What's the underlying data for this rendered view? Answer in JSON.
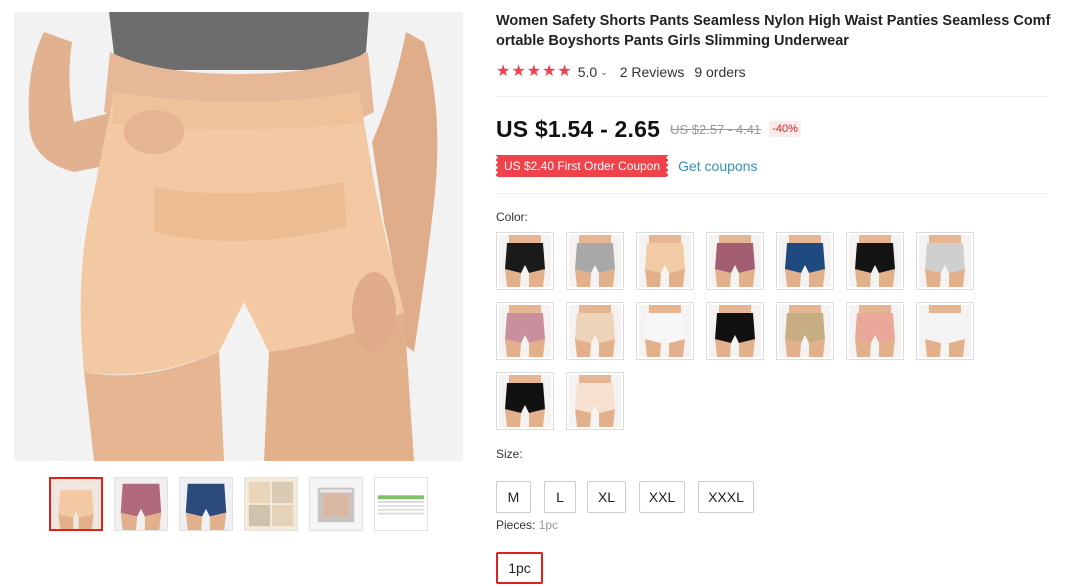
{
  "product": {
    "title": "Women Safety Shorts Pants Seamless Nylon High Waist Panties Seamless Comfortable Boyshorts Pants Girls Slimming Underwear",
    "rating": {
      "stars": 5,
      "value": "5.0",
      "reviews": "2 Reviews",
      "orders": "9 orders"
    },
    "price": {
      "current": "US $1.54 - 2.65",
      "original": "US $2.57 - 4.41",
      "discount": "-40%"
    },
    "coupon": {
      "label": "US $2.40 First Order Coupon",
      "get_link": "Get coupons"
    },
    "main_image": {
      "alt": "beige high waist shorts",
      "color": "#f3c9a4"
    },
    "thumbnails": [
      {
        "color": "#f3c9a4",
        "kind": "shorts"
      },
      {
        "color": "#b06a7c",
        "kind": "shorts"
      },
      {
        "color": "#2c4a7c",
        "kind": "shorts"
      },
      {
        "color": "#e9d5b8",
        "kind": "fabric"
      },
      {
        "color": "#c9c4c2",
        "kind": "package"
      },
      {
        "color": "#7fbf6a",
        "kind": "size-chart"
      }
    ],
    "color_option": {
      "label": "Color:",
      "swatches": [
        {
          "color": "#1a1a1a"
        },
        {
          "color": "#a8a8a8"
        },
        {
          "color": "#f1cba4"
        },
        {
          "color": "#a45e72"
        },
        {
          "color": "#1f4a80"
        },
        {
          "color": "#141414"
        },
        {
          "color": "#cfcfcf"
        },
        {
          "color": "#c98f9c"
        },
        {
          "color": "#edd3b8"
        },
        {
          "color": "#f7f7f7"
        },
        {
          "color": "#101010"
        },
        {
          "color": "#c7ad82"
        },
        {
          "color": "#e9a89a"
        },
        {
          "color": "#f4f4f4"
        },
        {
          "color": "#111111"
        },
        {
          "color": "#f6e1d0"
        }
      ]
    },
    "size_option": {
      "label": "Size:",
      "options": [
        "M",
        "L",
        "XL",
        "XXL",
        "XXXL"
      ]
    },
    "pieces_option": {
      "label": "Pieces:",
      "selected_value": "1pc",
      "options": [
        "1pc"
      ]
    }
  }
}
